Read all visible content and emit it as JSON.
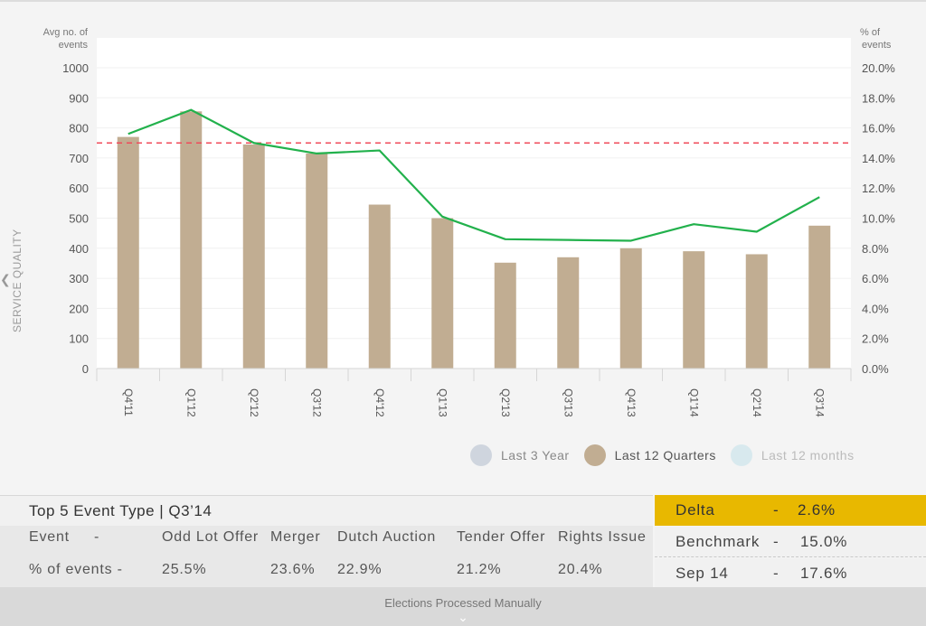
{
  "side_title": "SERVICE QUALITY",
  "chart_data": {
    "type": "bar",
    "categories": [
      "Q4'11",
      "Q1'12",
      "Q2'12",
      "Q3'12",
      "Q4'12",
      "Q1'13",
      "Q2'13",
      "Q3'13",
      "Q4'13",
      "Q1'14",
      "Q2'14",
      "Q3'14"
    ],
    "series": [
      {
        "axis": "left",
        "type": "bar",
        "color": "#c1ad92",
        "values": [
          770,
          855,
          745,
          715,
          545,
          500,
          352,
          370,
          400,
          390,
          380,
          475
        ]
      },
      {
        "axis": "right",
        "type": "line",
        "color": "#22b14c",
        "values": [
          15.6,
          17.2,
          15.0,
          14.3,
          14.5,
          10.1,
          8.6,
          8.55,
          8.5,
          9.6,
          9.1,
          11.4
        ]
      }
    ],
    "reference_line": {
      "axis": "left",
      "value": 750,
      "style": "dashed",
      "color": "#f04b5a"
    },
    "ylabel": "Avg no. of events",
    "y2label": "% of events",
    "ylim": [
      0,
      1000
    ],
    "y2lim": [
      0,
      20
    ],
    "yticks": [
      "0",
      "100",
      "200",
      "300",
      "400",
      "500",
      "600",
      "700",
      "800",
      "900",
      "1000"
    ],
    "y2ticks": [
      "0.0%",
      "2.0%",
      "4.0%",
      "6.0%",
      "8.0%",
      "10.0%",
      "12.0%",
      "14.0%",
      "16.0%",
      "18.0%",
      "20.0%"
    ],
    "grid": true,
    "legend_position": "bottom-right"
  },
  "legend": [
    {
      "label": "Last 3 Year",
      "color": "#cfd5de",
      "active": false
    },
    {
      "label": "Last 12 Quarters",
      "color": "#c1ad92",
      "active": true
    },
    {
      "label": "Last 12 months",
      "color": "#d8e9ee",
      "active": false
    }
  ],
  "events": {
    "title": "Top 5 Event Type | Q3’14",
    "row1_label": "Event",
    "row1_dash": "-",
    "row2_label": "% of events -",
    "types": [
      "Odd Lot Offer",
      "Merger",
      "Dutch Auction",
      "Tender Offer",
      "Rights Issue"
    ],
    "percents": [
      "25.5%",
      "23.6%",
      "22.9%",
      "21.2%",
      "20.4%"
    ]
  },
  "stats": {
    "delta_label": "Delta",
    "delta_dash": "-",
    "delta_value": "2.6%",
    "bench_label": "Benchmark",
    "bench_dash": "-",
    "bench_value": "15.0%",
    "sep_label": "Sep 14",
    "sep_dash": "-",
    "sep_value": "17.6%",
    "highlight_color": "#e8b800"
  },
  "footer": {
    "label": "Elections Processed Manually",
    "chevron": "⌄"
  }
}
